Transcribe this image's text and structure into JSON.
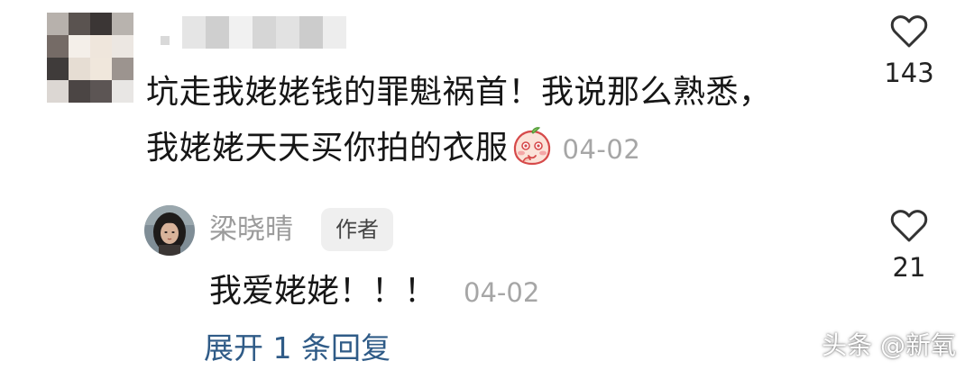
{
  "comment": {
    "username": "用户名",
    "text_line1": "坑走我姥姥钱的罪魁祸首！我说那么熟悉，",
    "text_line2": "我姥姥天天买你拍的衣服",
    "emoji": "shy-peach-emoji",
    "date": "04-02",
    "like_count": "143"
  },
  "reply": {
    "username": "梁晓晴",
    "badge": "作者",
    "text": "我爱姥姥！！！",
    "date": "04-02",
    "like_count": "21"
  },
  "expand_replies": "展开 1 条回复",
  "watermark": "头条 @新氧",
  "icons": {
    "like": "heart-outline-icon"
  },
  "colors": {
    "text": "#161616",
    "muted": "#a6a6a6",
    "link": "#2f5b87",
    "badge_bg": "#efefef"
  }
}
